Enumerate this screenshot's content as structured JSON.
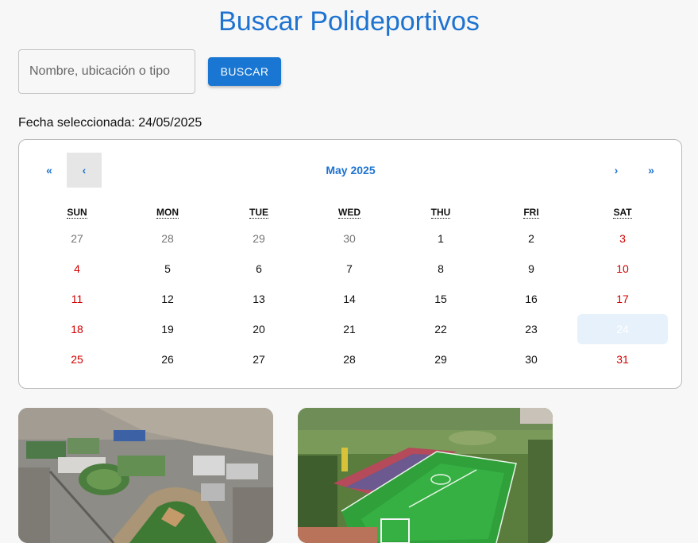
{
  "header": {
    "title": "Buscar Polideportivos"
  },
  "search": {
    "placeholder": "Nombre, ubicación o tipo",
    "button_label": "BUSCAR"
  },
  "selected_date_text": "Fecha seleccionada: 24/05/2025",
  "calendar": {
    "month_label": "May 2025",
    "nav": {
      "prev_year": "«",
      "prev_month": "‹",
      "next_month": "›",
      "next_year": "»"
    },
    "weekdays": [
      "SUN",
      "MON",
      "TUE",
      "WED",
      "THU",
      "FRI",
      "SAT"
    ],
    "weeks": [
      [
        "27",
        "28",
        "29",
        "30",
        "1",
        "2",
        "3"
      ],
      [
        "4",
        "5",
        "6",
        "7",
        "8",
        "9",
        "10"
      ],
      [
        "11",
        "12",
        "13",
        "14",
        "15",
        "16",
        "17"
      ],
      [
        "18",
        "19",
        "20",
        "21",
        "22",
        "23",
        "24"
      ],
      [
        "25",
        "26",
        "27",
        "28",
        "29",
        "30",
        "31"
      ]
    ],
    "selected_day": "24",
    "colors": {
      "accent": "#1e73d1",
      "weekend": "#d10000",
      "selected_bg": "#e6f1fc"
    }
  },
  "cards": [
    {
      "image": "stadium-aerial-photo"
    },
    {
      "image": "soccer-field-aerial-photo"
    }
  ]
}
